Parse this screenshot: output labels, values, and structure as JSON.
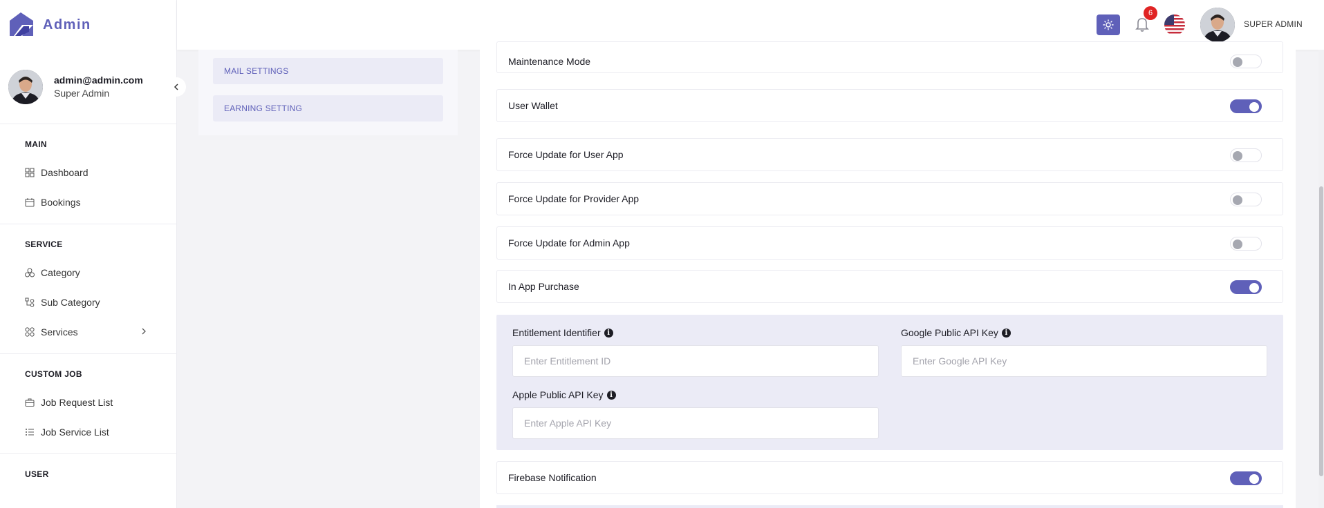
{
  "brand": {
    "name": "Admin"
  },
  "sidebar_user": {
    "email": "admin@admin.com",
    "role": "Super Admin"
  },
  "sidebar": {
    "sections": [
      {
        "heading": "MAIN",
        "items": [
          "Dashboard",
          "Bookings"
        ]
      },
      {
        "heading": "SERVICE",
        "items": [
          "Category",
          "Sub Category",
          "Services"
        ]
      },
      {
        "heading": "CUSTOM JOB",
        "items": [
          "Job Request List",
          "Job Service List"
        ]
      },
      {
        "heading": "USER",
        "items": []
      }
    ]
  },
  "header": {
    "notification_count": "6",
    "user_name": "SUPER ADMIN"
  },
  "settings_menu": {
    "mail_settings": "MAIL SETTINGS",
    "earning_setting": "EARNING SETTING"
  },
  "settings": {
    "maintenance_mode": {
      "label": "Maintenance Mode",
      "enabled": false
    },
    "user_wallet": {
      "label": "User Wallet",
      "enabled": true
    },
    "force_update_user": {
      "label": "Force Update for User App",
      "enabled": false
    },
    "force_update_provider": {
      "label": "Force Update for Provider App",
      "enabled": false
    },
    "force_update_admin": {
      "label": "Force Update for Admin App",
      "enabled": false
    },
    "in_app_purchase": {
      "label": "In App Purchase",
      "enabled": true
    },
    "firebase_notification": {
      "label": "Firebase Notification",
      "enabled": true
    }
  },
  "iap_fields": {
    "entitlement": {
      "label": "Entitlement Identifier",
      "placeholder": "Enter Entitlement ID",
      "value": ""
    },
    "google_key": {
      "label": "Google Public API Key",
      "placeholder": "Enter Google API Key",
      "value": ""
    },
    "apple_key": {
      "label": "Apple Public API Key",
      "placeholder": "Enter Apple API Key",
      "value": ""
    }
  },
  "colors": {
    "accent": "#5f60b9",
    "badge": "#e02424",
    "panel": "#ebebf6"
  }
}
